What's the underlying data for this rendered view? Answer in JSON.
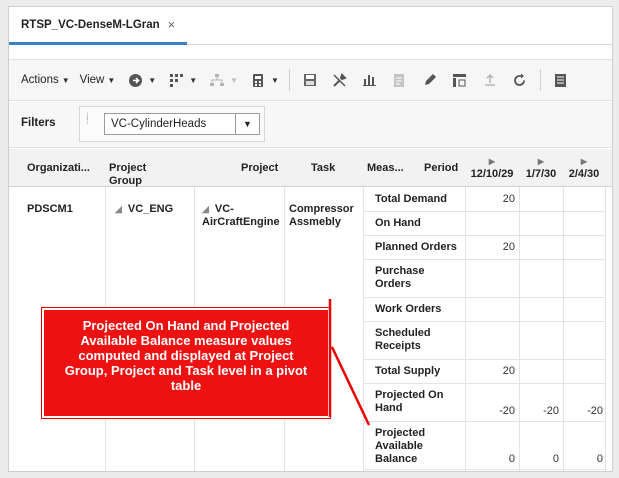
{
  "tab": {
    "title": "RTSP_VC-DenseM-LGran",
    "close": "×"
  },
  "toolbar": {
    "actions_label": "Actions",
    "view_label": "View",
    "icons": [
      "go-icon",
      "layout-icon",
      "hierarchy-icon",
      "calculator-icon",
      "save-icon",
      "tools-icon",
      "chart-icon",
      "document-icon",
      "edit-icon",
      "pivot-icon",
      "export-icon",
      "refresh-icon",
      "sheet-icon"
    ]
  },
  "filters": {
    "label": "Filters",
    "selected": "VC-CylinderHeads"
  },
  "pivot": {
    "headers": {
      "organization": "Organizati...",
      "project_group": "Project Group",
      "project": "Project",
      "task": "Task",
      "measure": "Meas...",
      "period": "Period"
    },
    "periods": [
      "12/10/29",
      "1/7/30",
      "2/4/30"
    ],
    "row": {
      "organization": "PDSCM1",
      "project_group": "VC_ENG",
      "project": "VC-AirCraftEngine",
      "project_line1": "VC-",
      "project_line2": "AirCraftEngine",
      "task_line1": "Compressor",
      "task_line2": "Assmebly"
    },
    "measures": [
      {
        "name": "Total Demand",
        "values": [
          "20",
          "",
          ""
        ]
      },
      {
        "name": "On Hand",
        "values": [
          "",
          "",
          ""
        ]
      },
      {
        "name": "Planned Orders",
        "values": [
          "20",
          "",
          ""
        ]
      },
      {
        "name": "Purchase Orders",
        "line1": "Purchase",
        "line2": "Orders",
        "values": [
          "",
          "",
          ""
        ]
      },
      {
        "name": "Work Orders",
        "values": [
          "",
          "",
          ""
        ]
      },
      {
        "name": "Scheduled Receipts",
        "line1": "Scheduled",
        "line2": "Receipts",
        "values": [
          "",
          "",
          ""
        ]
      },
      {
        "name": "Total Supply",
        "values": [
          "20",
          "",
          ""
        ]
      },
      {
        "name": "Projected On Hand",
        "line1": "Projected On",
        "line2": "Hand",
        "values": [
          "-20",
          "-20",
          "-20"
        ]
      },
      {
        "name": "Projected Available Balance",
        "line1": "Projected",
        "line2": "Available",
        "line3": "Balance",
        "values": [
          "0",
          "0",
          "0"
        ]
      }
    ]
  },
  "callout": {
    "text": "Projected On Hand and Projected Available Balance measure values computed and displayed at Project Group, Project and Task level in a pivot table"
  },
  "colors": {
    "callout_bg": "#ee1111",
    "tab_accent": "#3a7ec6"
  }
}
